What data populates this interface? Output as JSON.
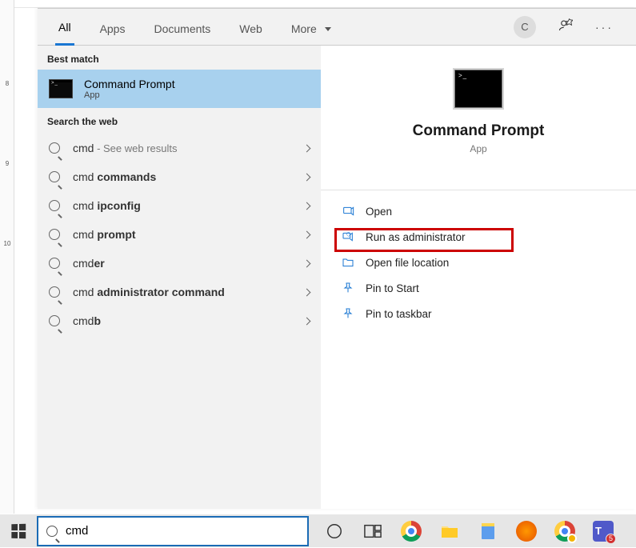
{
  "ruler": {
    "m8": "8",
    "m9": "9",
    "m10": "10"
  },
  "tabs": {
    "all": "All",
    "apps": "Apps",
    "documents": "Documents",
    "web": "Web",
    "more": "More"
  },
  "avatar_initial": "C",
  "sections": {
    "best_match": "Best match",
    "search_web": "Search the web"
  },
  "best_match": {
    "title": "Command Prompt",
    "sub": "App"
  },
  "web_results": [
    {
      "prefix": "cmd",
      "bold": "",
      "suffix": " - See web results"
    },
    {
      "prefix": "cmd ",
      "bold": "commands",
      "suffix": ""
    },
    {
      "prefix": "cmd ",
      "bold": "ipconfig",
      "suffix": ""
    },
    {
      "prefix": "cmd ",
      "bold": "prompt",
      "suffix": ""
    },
    {
      "prefix": "cmd",
      "bold": "er",
      "suffix": ""
    },
    {
      "prefix": "cmd ",
      "bold": "administrator command",
      "suffix": ""
    },
    {
      "prefix": "cmd",
      "bold": "b",
      "suffix": ""
    }
  ],
  "preview": {
    "title": "Command Prompt",
    "sub": "App"
  },
  "actions": {
    "open": "Open",
    "run_admin": "Run as administrator",
    "open_loc": "Open file location",
    "pin_start": "Pin to Start",
    "pin_taskbar": "Pin to taskbar"
  },
  "search_query": "cmd"
}
